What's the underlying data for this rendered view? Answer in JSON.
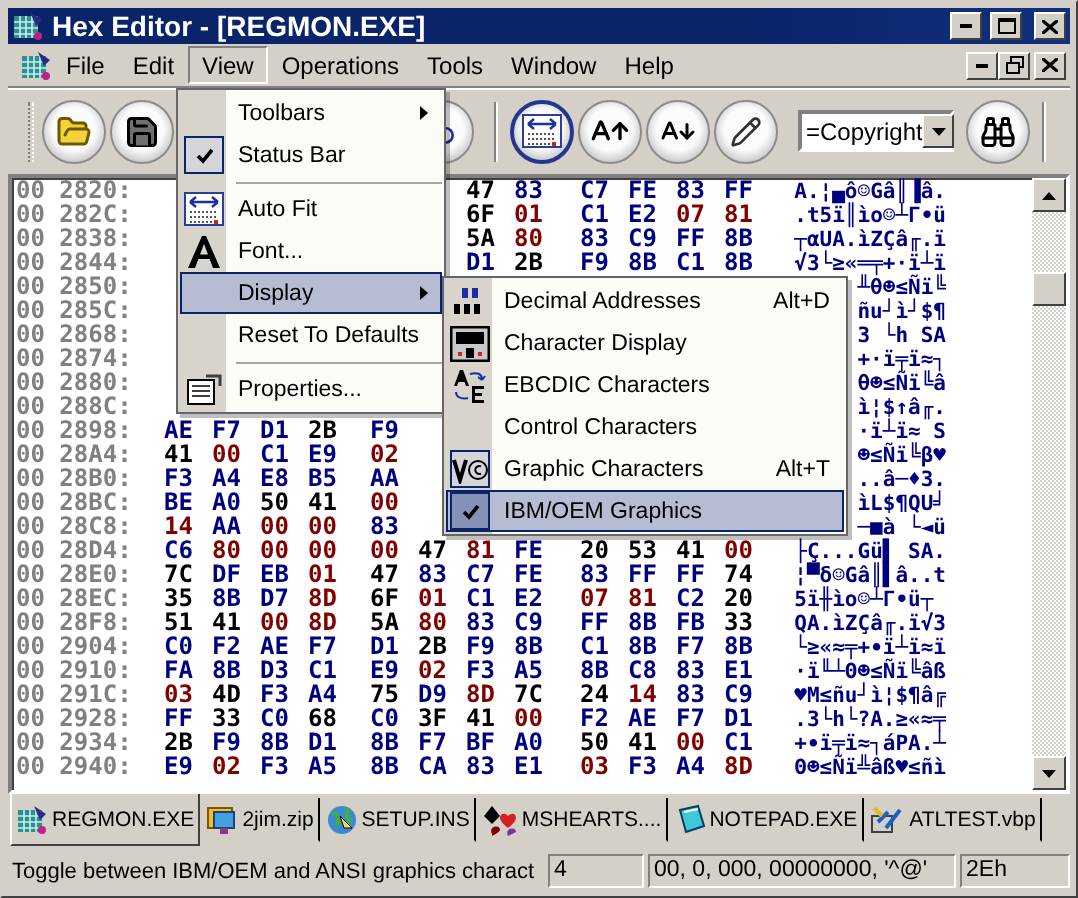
{
  "window": {
    "title": "Hex Editor - [REGMON.EXE]"
  },
  "menu_bar": [
    {
      "label": "File",
      "selected": false
    },
    {
      "label": "Edit",
      "selected": false
    },
    {
      "label": "View",
      "selected": true
    },
    {
      "label": "Operations",
      "selected": false
    },
    {
      "label": "Tools",
      "selected": false
    },
    {
      "label": "Window",
      "selected": false
    },
    {
      "label": "Help",
      "selected": false
    }
  ],
  "toolbar": {
    "auto_fit": {
      "on": true
    },
    "find_combo": {
      "value": "=Copyright"
    }
  },
  "hex_view": {
    "rows": [
      {
        "kind": "end",
        "address": "00 2820:",
        "bytes": [
          {
            "value": "47",
            "color": "#000000"
          },
          {
            "value": "83",
            "color": "#000080"
          },
          {
            "value": "C7",
            "color": "#000080"
          },
          {
            "value": "FE",
            "color": "#000080"
          },
          {
            "value": "83",
            "color": "#000080"
          },
          {
            "value": "FF",
            "color": "#000080"
          }
        ],
        "chars": "A.¦▄ô☺Gâ║▐â."
      },
      {
        "kind": "end",
        "address": "00 282C:",
        "bytes": [
          {
            "value": "6F",
            "color": "#000000"
          },
          {
            "value": "01",
            "color": "#800000"
          },
          {
            "value": "C1",
            "color": "#000080"
          },
          {
            "value": "E2",
            "color": "#000080"
          },
          {
            "value": "07",
            "color": "#800000"
          },
          {
            "value": "81",
            "color": "#800000"
          }
        ],
        "chars": ".t5ï║ìo☺┴Γ•ü"
      },
      {
        "kind": "end",
        "address": "00 2838:",
        "bytes": [
          {
            "value": "5A",
            "color": "#000000"
          },
          {
            "value": "80",
            "color": "#800000"
          },
          {
            "value": "83",
            "color": "#000080"
          },
          {
            "value": "C9",
            "color": "#000080"
          },
          {
            "value": "FF",
            "color": "#000080"
          },
          {
            "value": "8B",
            "color": "#000080"
          }
        ],
        "chars": "┬αUA.ìZÇâ╓.ï"
      },
      {
        "kind": "end",
        "address": "00 2844:",
        "bytes": [
          {
            "value": "D1",
            "color": "#000080"
          },
          {
            "value": "2B",
            "color": "#000000"
          },
          {
            "value": "F9",
            "color": "#000080"
          },
          {
            "value": "8B",
            "color": "#000080"
          },
          {
            "value": "C1",
            "color": "#000080"
          },
          {
            "value": "8B",
            "color": "#000080"
          }
        ],
        "chars": "√3└≥«═╤+·ï┴ï"
      },
      {
        "kind": "covered",
        "address": "00 2850:",
        "chars": "╨θ☻≤Ñï╚"
      },
      {
        "kind": "covered",
        "address": "00 285C:",
        "chars": "ñu┘ì┘$¶"
      },
      {
        "kind": "covered",
        "address": "00 2868:",
        "chars": "3 └h SA"
      },
      {
        "kind": "covered",
        "address": "00 2874:",
        "chars": "+·ï╤ï≈┐"
      },
      {
        "kind": "covered",
        "address": "00 2880:",
        "chars": "θ☻≤Ñï╚â"
      },
      {
        "kind": "covered",
        "address": "00 288C:",
        "chars": "ì¦$↑â╓."
      },
      {
        "kind": "start",
        "address": "00 2898:",
        "bytes": [
          {
            "value": "AE",
            "color": "#000080"
          },
          {
            "value": "F7",
            "color": "#000080"
          },
          {
            "value": "D1",
            "color": "#000080"
          },
          {
            "value": "2B",
            "color": "#000000"
          },
          {
            "value": "F9",
            "color": "#000080"
          }
        ],
        "chars": "·ï┴ï≈ S"
      },
      {
        "kind": "start",
        "address": "00 28A4:",
        "bytes": [
          {
            "value": "41",
            "color": "#000000"
          },
          {
            "value": "00",
            "color": "#800000"
          },
          {
            "value": "C1",
            "color": "#000080"
          },
          {
            "value": "E9",
            "color": "#000080"
          },
          {
            "value": "02",
            "color": "#800000"
          }
        ],
        "chars": "☻≤Ñï╚β♥"
      },
      {
        "kind": "start",
        "address": "00 28B0:",
        "bytes": [
          {
            "value": "F3",
            "color": "#000080"
          },
          {
            "value": "A4",
            "color": "#000080"
          },
          {
            "value": "E8",
            "color": "#000080"
          },
          {
            "value": "B5",
            "color": "#000080"
          },
          {
            "value": "AA",
            "color": "#000080"
          }
        ],
        "chars": "..â─♦3."
      },
      {
        "kind": "start",
        "address": "00 28BC:",
        "bytes": [
          {
            "value": "BE",
            "color": "#000080"
          },
          {
            "value": "A0",
            "color": "#000080"
          },
          {
            "value": "50",
            "color": "#000000"
          },
          {
            "value": "41",
            "color": "#000000"
          },
          {
            "value": "00",
            "color": "#800000"
          }
        ],
        "chars": "ìL$¶QU╛"
      },
      {
        "kind": "start",
        "address": "00 28C8:",
        "bytes": [
          {
            "value": "14",
            "color": "#800000"
          },
          {
            "value": "AA",
            "color": "#000080"
          },
          {
            "value": "00",
            "color": "#800000"
          },
          {
            "value": "00",
            "color": "#800000"
          },
          {
            "value": "83",
            "color": "#000080"
          }
        ],
        "chars": "─■à └◄ü"
      },
      {
        "kind": "full",
        "address": "00 28D4:",
        "bytes": [
          {
            "value": "C6",
            "color": "#000080"
          },
          {
            "value": "80",
            "color": "#800000"
          },
          {
            "value": "00",
            "color": "#800000"
          },
          {
            "value": "00",
            "color": "#800000"
          },
          {
            "value": "00",
            "color": "#800000"
          },
          {
            "value": "47",
            "color": "#000000"
          },
          {
            "value": "81",
            "color": "#800000"
          },
          {
            "value": "FE",
            "color": "#000080"
          },
          {
            "value": "20",
            "color": "#000000"
          },
          {
            "value": "53",
            "color": "#000000"
          },
          {
            "value": "41",
            "color": "#000000"
          },
          {
            "value": "00",
            "color": "#800000"
          }
        ],
        "chars": "├Ç...Gü▌ SA."
      },
      {
        "kind": "full",
        "address": "00 28E0:",
        "bytes": [
          {
            "value": "7C",
            "color": "#000000"
          },
          {
            "value": "DF",
            "color": "#000080"
          },
          {
            "value": "EB",
            "color": "#000080"
          },
          {
            "value": "01",
            "color": "#800000"
          },
          {
            "value": "47",
            "color": "#000000"
          },
          {
            "value": "83",
            "color": "#000080"
          },
          {
            "value": "C7",
            "color": "#000080"
          },
          {
            "value": "FE",
            "color": "#000080"
          },
          {
            "value": "83",
            "color": "#000080"
          },
          {
            "value": "FF",
            "color": "#000080"
          },
          {
            "value": "FF",
            "color": "#000080"
          },
          {
            "value": "74",
            "color": "#000000"
          }
        ],
        "chars": "¦▀δ☺Gâ║▌â..t"
      },
      {
        "kind": "full",
        "address": "00 28EC:",
        "bytes": [
          {
            "value": "35",
            "color": "#000000"
          },
          {
            "value": "8B",
            "color": "#000080"
          },
          {
            "value": "D7",
            "color": "#000080"
          },
          {
            "value": "8D",
            "color": "#800000"
          },
          {
            "value": "6F",
            "color": "#000000"
          },
          {
            "value": "01",
            "color": "#800000"
          },
          {
            "value": "C1",
            "color": "#000080"
          },
          {
            "value": "E2",
            "color": "#000080"
          },
          {
            "value": "07",
            "color": "#800000"
          },
          {
            "value": "81",
            "color": "#800000"
          },
          {
            "value": "C2",
            "color": "#000080"
          },
          {
            "value": "20",
            "color": "#000000"
          }
        ],
        "chars": "5ï╫ìo☺┴Γ•ü┬ "
      },
      {
        "kind": "full",
        "address": "00 28F8:",
        "bytes": [
          {
            "value": "51",
            "color": "#000000"
          },
          {
            "value": "41",
            "color": "#000000"
          },
          {
            "value": "00",
            "color": "#800000"
          },
          {
            "value": "8D",
            "color": "#800000"
          },
          {
            "value": "5A",
            "color": "#000000"
          },
          {
            "value": "80",
            "color": "#800000"
          },
          {
            "value": "83",
            "color": "#000080"
          },
          {
            "value": "C9",
            "color": "#000080"
          },
          {
            "value": "FF",
            "color": "#000080"
          },
          {
            "value": "8B",
            "color": "#000080"
          },
          {
            "value": "FB",
            "color": "#000080"
          },
          {
            "value": "33",
            "color": "#000000"
          }
        ],
        "chars": "QA.ìZÇâ╓.ï√3"
      },
      {
        "kind": "full",
        "address": "00 2904:",
        "bytes": [
          {
            "value": "C0",
            "color": "#000080"
          },
          {
            "value": "F2",
            "color": "#000080"
          },
          {
            "value": "AE",
            "color": "#000080"
          },
          {
            "value": "F7",
            "color": "#000080"
          },
          {
            "value": "D1",
            "color": "#000080"
          },
          {
            "value": "2B",
            "color": "#000000"
          },
          {
            "value": "F9",
            "color": "#000080"
          },
          {
            "value": "8B",
            "color": "#000080"
          },
          {
            "value": "C1",
            "color": "#000080"
          },
          {
            "value": "8B",
            "color": "#000080"
          },
          {
            "value": "F7",
            "color": "#000080"
          },
          {
            "value": "8B",
            "color": "#000080"
          }
        ],
        "chars": "└≥«≈╤+∙ï┴ï≈ï"
      },
      {
        "kind": "full",
        "address": "00 2910:",
        "bytes": [
          {
            "value": "FA",
            "color": "#000080"
          },
          {
            "value": "8B",
            "color": "#000080"
          },
          {
            "value": "D3",
            "color": "#000080"
          },
          {
            "value": "C1",
            "color": "#000080"
          },
          {
            "value": "E9",
            "color": "#000080"
          },
          {
            "value": "02",
            "color": "#800000"
          },
          {
            "value": "F3",
            "color": "#000080"
          },
          {
            "value": "A5",
            "color": "#000080"
          },
          {
            "value": "8B",
            "color": "#000080"
          },
          {
            "value": "C8",
            "color": "#000080"
          },
          {
            "value": "83",
            "color": "#000080"
          },
          {
            "value": "E1",
            "color": "#000080"
          }
        ],
        "chars": "·ï╙┴Θ☻≤Ñï╚âß"
      },
      {
        "kind": "full",
        "address": "00 291C:",
        "bytes": [
          {
            "value": "03",
            "color": "#800000"
          },
          {
            "value": "4D",
            "color": "#000000"
          },
          {
            "value": "F3",
            "color": "#000080"
          },
          {
            "value": "A4",
            "color": "#000080"
          },
          {
            "value": "75",
            "color": "#000000"
          },
          {
            "value": "D9",
            "color": "#000080"
          },
          {
            "value": "8D",
            "color": "#800000"
          },
          {
            "value": "7C",
            "color": "#000000"
          },
          {
            "value": "24",
            "color": "#000000"
          },
          {
            "value": "14",
            "color": "#800000"
          },
          {
            "value": "83",
            "color": "#000080"
          },
          {
            "value": "C9",
            "color": "#000080"
          }
        ],
        "chars": "♥M≤ñu┘ì¦$¶â╔"
      },
      {
        "kind": "full",
        "address": "00 2928:",
        "bytes": [
          {
            "value": "FF",
            "color": "#000080"
          },
          {
            "value": "33",
            "color": "#000000"
          },
          {
            "value": "C0",
            "color": "#000080"
          },
          {
            "value": "68",
            "color": "#000000"
          },
          {
            "value": "C0",
            "color": "#000080"
          },
          {
            "value": "3F",
            "color": "#000000"
          },
          {
            "value": "41",
            "color": "#000000"
          },
          {
            "value": "00",
            "color": "#800000"
          },
          {
            "value": "F2",
            "color": "#000080"
          },
          {
            "value": "AE",
            "color": "#000080"
          },
          {
            "value": "F7",
            "color": "#000080"
          },
          {
            "value": "D1",
            "color": "#000080"
          }
        ],
        "chars": ".3└h└?A.≥«≈╤"
      },
      {
        "kind": "full",
        "address": "00 2934:",
        "bytes": [
          {
            "value": "2B",
            "color": "#000000"
          },
          {
            "value": "F9",
            "color": "#000080"
          },
          {
            "value": "8B",
            "color": "#000080"
          },
          {
            "value": "D1",
            "color": "#000080"
          },
          {
            "value": "8B",
            "color": "#000080"
          },
          {
            "value": "F7",
            "color": "#000080"
          },
          {
            "value": "BF",
            "color": "#000080"
          },
          {
            "value": "A0",
            "color": "#000080"
          },
          {
            "value": "50",
            "color": "#000000"
          },
          {
            "value": "41",
            "color": "#000000"
          },
          {
            "value": "00",
            "color": "#800000"
          },
          {
            "value": "C1",
            "color": "#000080"
          }
        ],
        "chars": "+∙ï╤ï≈┐áPA.┴"
      },
      {
        "kind": "full",
        "address": "00 2940:",
        "bytes": [
          {
            "value": "E9",
            "color": "#000080"
          },
          {
            "value": "02",
            "color": "#800000"
          },
          {
            "value": "F3",
            "color": "#000080"
          },
          {
            "value": "A5",
            "color": "#000080"
          },
          {
            "value": "8B",
            "color": "#000080"
          },
          {
            "value": "CA",
            "color": "#000080"
          },
          {
            "value": "83",
            "color": "#000080"
          },
          {
            "value": "E1",
            "color": "#000080"
          },
          {
            "value": "03",
            "color": "#800000"
          },
          {
            "value": "F3",
            "color": "#000080"
          },
          {
            "value": "A4",
            "color": "#000080"
          },
          {
            "value": "8D",
            "color": "#800000"
          }
        ],
        "chars": "Θ☻≤Ñï╩âß♥≤ñì"
      }
    ]
  },
  "view_menu": {
    "items": [
      {
        "kind": "submenu",
        "label": "Toolbars",
        "selected": false
      },
      {
        "kind": "check",
        "label": "Status Bar",
        "checked": true,
        "selected": false
      },
      {
        "kind": "separator"
      },
      {
        "kind": "command",
        "label": "Auto Fit",
        "selected": false
      },
      {
        "kind": "command",
        "label": "Font...",
        "selected": false
      },
      {
        "kind": "submenu",
        "label": "Display",
        "selected": true
      },
      {
        "kind": "command",
        "label": "Reset To Defaults",
        "selected": false
      },
      {
        "kind": "separator"
      },
      {
        "kind": "command",
        "label": "Properties...",
        "selected": false
      }
    ]
  },
  "display_submenu": {
    "items": [
      {
        "label": "Decimal Addresses",
        "shortcut": "Alt+D",
        "checked": false,
        "selected": false
      },
      {
        "label": "Character Display",
        "checked": false,
        "selected": false
      },
      {
        "label": "EBCDIC Characters",
        "checked": false,
        "selected": false
      },
      {
        "label": "Control Characters",
        "checked": false,
        "selected": false
      },
      {
        "label": "Graphic Characters",
        "shortcut": "Alt+T",
        "checked": true,
        "selected": false
      },
      {
        "label": "IBM/OEM Graphics",
        "checked": true,
        "selected": true
      }
    ]
  },
  "tabs": [
    {
      "label": "REGMON.EXE",
      "selected": true
    },
    {
      "label": "2jim.zip",
      "selected": false
    },
    {
      "label": "SETUP.INS",
      "selected": false
    },
    {
      "label": "MSHEARTS....",
      "selected": false
    },
    {
      "label": "NOTEPAD.EXE",
      "selected": false
    },
    {
      "label": "ATLTEST.vbp",
      "selected": false
    }
  ],
  "status_bar": {
    "message": "Toggle between IBM/OEM and ANSI graphics charact",
    "panes": [
      "4",
      "00, 0, 000, 00000000, '^@'",
      "2Eh"
    ]
  }
}
